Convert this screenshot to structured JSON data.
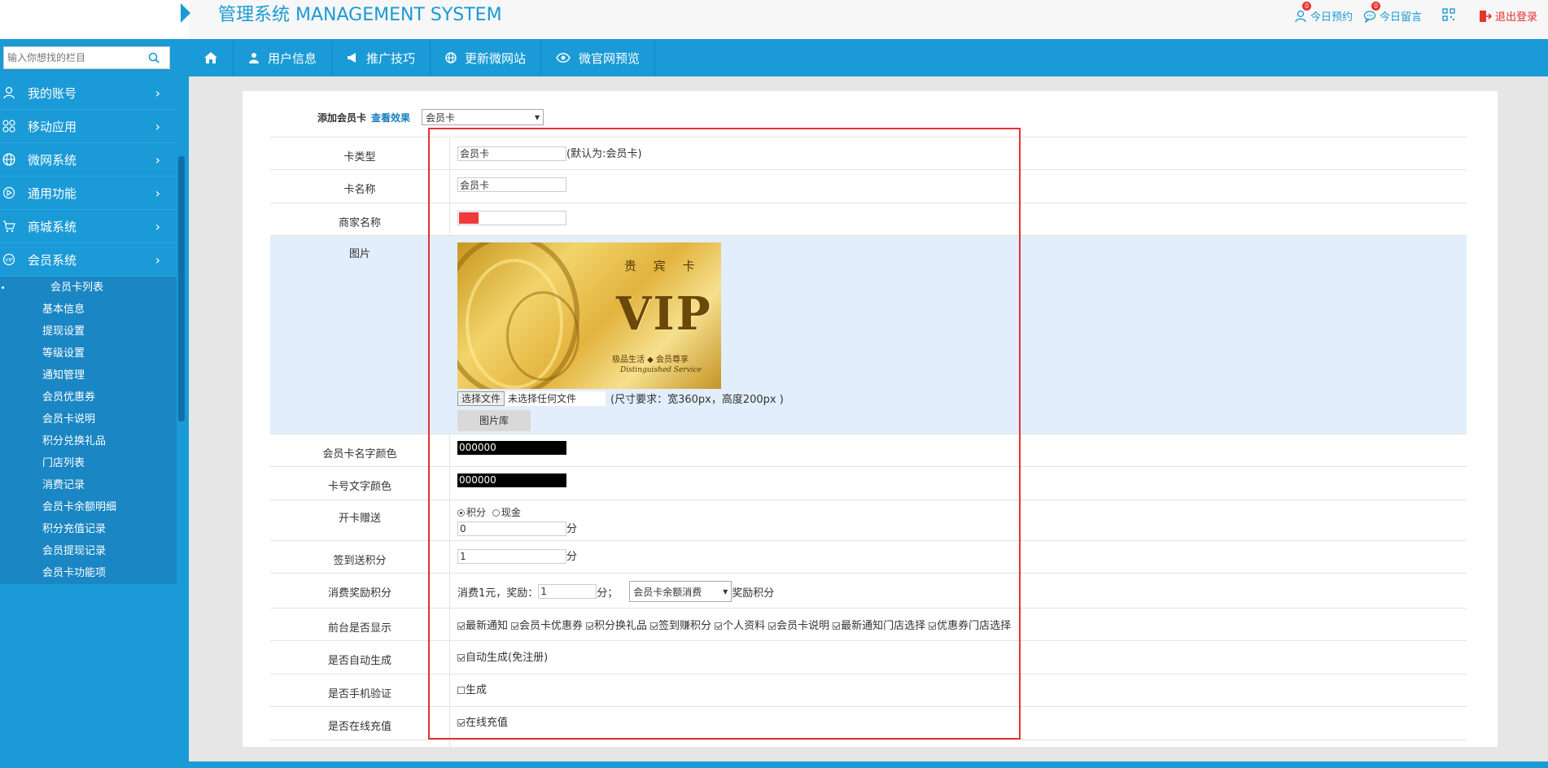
{
  "header": {
    "app_title": "管理系统 MANAGEMENT SYSTEM",
    "links": [
      {
        "label": "今日预约",
        "badge": "0"
      },
      {
        "label": "今日留言",
        "badge": "0"
      }
    ],
    "logout_label": "退出登录"
  },
  "search": {
    "placeholder": "输入你想找的栏目"
  },
  "nav": {
    "items": [
      "用户信息",
      "推广技巧",
      "更新微网站",
      "微官网预览"
    ]
  },
  "sidebar": {
    "menus": [
      "我的账号",
      "移动应用",
      "微网系统",
      "通用功能",
      "商城系统",
      "会员系统"
    ],
    "submenu": [
      "会员卡列表",
      "基本信息",
      "提现设置",
      "等级设置",
      "通知管理",
      "会员优惠券",
      "会员卡说明",
      "积分兑换礼品",
      "门店列表",
      "消费记录",
      "会员卡余额明细",
      "积分充值记录",
      "会员提现记录",
      "会员卡功能项"
    ]
  },
  "form": {
    "add_card_label": "添加会员卡",
    "view_effect_label": "查看效果",
    "card_select": "会员卡",
    "rows": {
      "card_type": {
        "label": "卡类型",
        "value": "会员卡",
        "hint": "(默认为:会员卡)"
      },
      "card_name": {
        "label": "卡名称",
        "value": "会员卡"
      },
      "merchant_name": {
        "label": "商家名称"
      },
      "image": {
        "label": "图片",
        "card_title": "贵 宾 卡",
        "card_vip": "VIP",
        "card_tag": "极品生活 ◆ 会员尊享",
        "card_tag2": "Distinguished Service",
        "choose_file": "选择文件",
        "no_file": "未选择任何文件",
        "size_hint": "(尺寸要求：宽360px，高度200px )",
        "gallery_button": "图片库"
      },
      "name_color": {
        "label": "会员卡名字颜色",
        "value": "000000"
      },
      "number_color": {
        "label": "卡号文字颜色",
        "value": "000000"
      },
      "open_gift": {
        "label": "开卡赠送",
        "opt_points": "积分",
        "opt_cash": "现金",
        "value": "0",
        "unit": "分"
      },
      "signin_points": {
        "label": "签到送积分",
        "value": "1",
        "unit": "分"
      },
      "consume_reward": {
        "label": "消费奖励积分",
        "prefix": "消费1元，奖励：",
        "value": "1",
        "unit": "分；",
        "select": "会员卡余额消费",
        "suffix": "奖励积分"
      },
      "front_display": {
        "label": "前台是否显示",
        "options": [
          "最新通知",
          "会员卡优惠券",
          "积分换礼品",
          "签到赚积分",
          "个人资料",
          "会员卡说明",
          "最新通知门店选择",
          "优惠券门店选择"
        ]
      },
      "auto_generate": {
        "label": "是否自动生成",
        "option": "自动生成(免注册)"
      },
      "phone_verify": {
        "label": "是否手机验证",
        "option": "生成"
      },
      "online_recharge": {
        "label": "是否在线充值",
        "option": "在线充值"
      }
    }
  },
  "colors": {
    "accent": "#1a9ad6",
    "danger": "#e5322d",
    "highlight_row": "#e2eefb"
  }
}
